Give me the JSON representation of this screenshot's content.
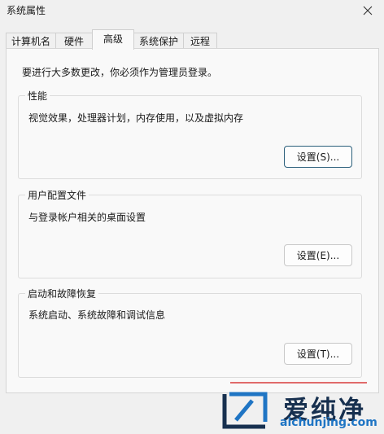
{
  "window": {
    "title": "系统属性"
  },
  "tabs": [
    {
      "label": "计算机名"
    },
    {
      "label": "硬件"
    },
    {
      "label": "高级"
    },
    {
      "label": "系统保护"
    },
    {
      "label": "远程"
    }
  ],
  "active_tab": "高级",
  "notice": "要进行大多数更改，你必须作为管理员登录。",
  "groups": {
    "performance": {
      "title": "性能",
      "desc": "视觉效果，处理器计划，内存使用，以及虚拟内存",
      "button": "设置(S)..."
    },
    "profile": {
      "title": "用户配置文件",
      "desc": "与登录帐户相关的桌面设置",
      "button": "设置(E)..."
    },
    "startup": {
      "title": "启动和故障恢复",
      "desc": "系统启动、系统故障和调试信息",
      "button": "设置(T)..."
    }
  },
  "watermark": {
    "brand": "爱纯净",
    "url": "aichunjing.com"
  },
  "colors": {
    "accent_border": "#2a5e7a",
    "watermark_text": "#17304f",
    "watermark_url": "#1f75c4"
  }
}
